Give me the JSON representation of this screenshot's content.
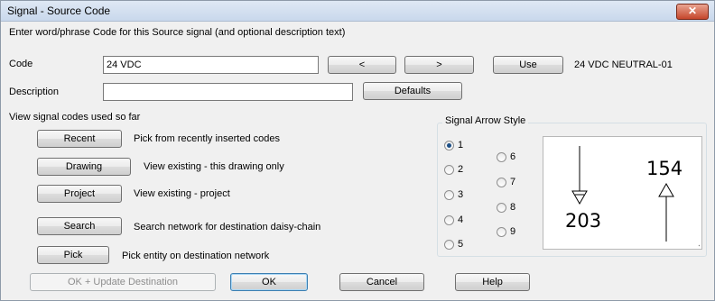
{
  "window": {
    "title": "Signal - Source Code",
    "close_symbol": "✕"
  },
  "prompt": "Enter word/phrase Code for this Source signal (and optional description text)",
  "code": {
    "label": "Code",
    "value": "24 VDC",
    "prev_button": "<",
    "next_button": ">",
    "use_button": "Use",
    "use_value": "24 VDC NEUTRAL-01"
  },
  "description": {
    "label": "Description",
    "value": "",
    "defaults_button": "Defaults"
  },
  "view_section": {
    "heading": "View signal codes used so far",
    "items": [
      {
        "button": "Recent",
        "text": "Pick from recently inserted codes"
      },
      {
        "button": "Drawing",
        "text": "View existing - this drawing only"
      },
      {
        "button": "Project",
        "text": "View existing - project"
      },
      {
        "button": "Search",
        "text": "Search network for destination daisy-chain"
      },
      {
        "button": "Pick",
        "text": "Pick entity on destination network"
      }
    ]
  },
  "arrow_style": {
    "title": "Signal Arrow Style",
    "options": [
      "1",
      "2",
      "3",
      "4",
      "5",
      "6",
      "7",
      "8",
      "9"
    ],
    "selected": "1",
    "preview": {
      "down_label": "203",
      "up_label": "154"
    }
  },
  "footer": {
    "ok_update": "OK + Update Destination",
    "ok": "OK",
    "cancel": "Cancel",
    "help": "Help"
  },
  "colors": {
    "title_bar": "#c9d8ec",
    "close_button": "#c5462b",
    "default_button_border": "#3c7fb1"
  }
}
